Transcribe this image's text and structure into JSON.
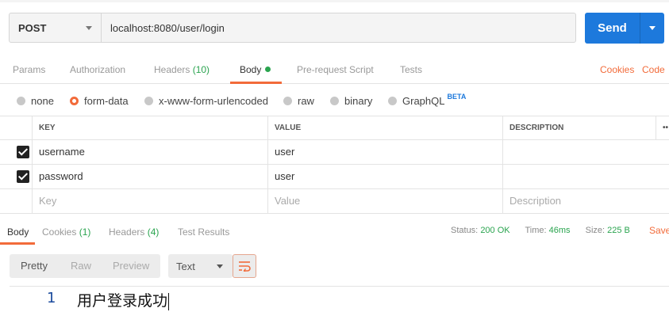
{
  "request": {
    "method": "POST",
    "url": "localhost:8080/user/login",
    "send_label": "Send"
  },
  "request_tabs": {
    "params": "Params",
    "authorization": "Authorization",
    "headers_label": "Headers",
    "headers_count": "(10)",
    "body": "Body",
    "prerequest": "Pre-request Script",
    "tests": "Tests",
    "cookies": "Cookies",
    "code": "Code"
  },
  "body_types": {
    "none": "none",
    "form_data": "form-data",
    "urlencoded": "x-www-form-urlencoded",
    "raw": "raw",
    "binary": "binary",
    "graphql": "GraphQL",
    "graphql_badge": "BETA",
    "selected": "form-data"
  },
  "kv_table": {
    "headers": {
      "key": "KEY",
      "value": "VALUE",
      "description": "DESCRIPTION",
      "more": "••"
    },
    "rows": [
      {
        "checked": true,
        "key": "username",
        "value": "user",
        "description": ""
      },
      {
        "checked": true,
        "key": "password",
        "value": "user",
        "description": ""
      }
    ],
    "placeholder": {
      "key": "Key",
      "value": "Value",
      "description": "Description"
    }
  },
  "response_tabs": {
    "body": "Body",
    "cookies_label": "Cookies",
    "cookies_count": "(1)",
    "headers_label": "Headers",
    "headers_count": "(4)",
    "test_results": "Test Results"
  },
  "response_status": {
    "status_label": "Status:",
    "status_value": "200 OK",
    "time_label": "Time:",
    "time_value": "46ms",
    "size_label": "Size:",
    "size_value": "225 B",
    "save": "Save"
  },
  "view_toolbar": {
    "pretty": "Pretty",
    "raw": "Raw",
    "preview": "Preview",
    "format": "Text"
  },
  "response_body": {
    "line_number": "1",
    "text": "用户登录成功"
  },
  "colors": {
    "accent": "#f26b3a",
    "send": "#1d79dc",
    "success": "#2aa44f"
  }
}
